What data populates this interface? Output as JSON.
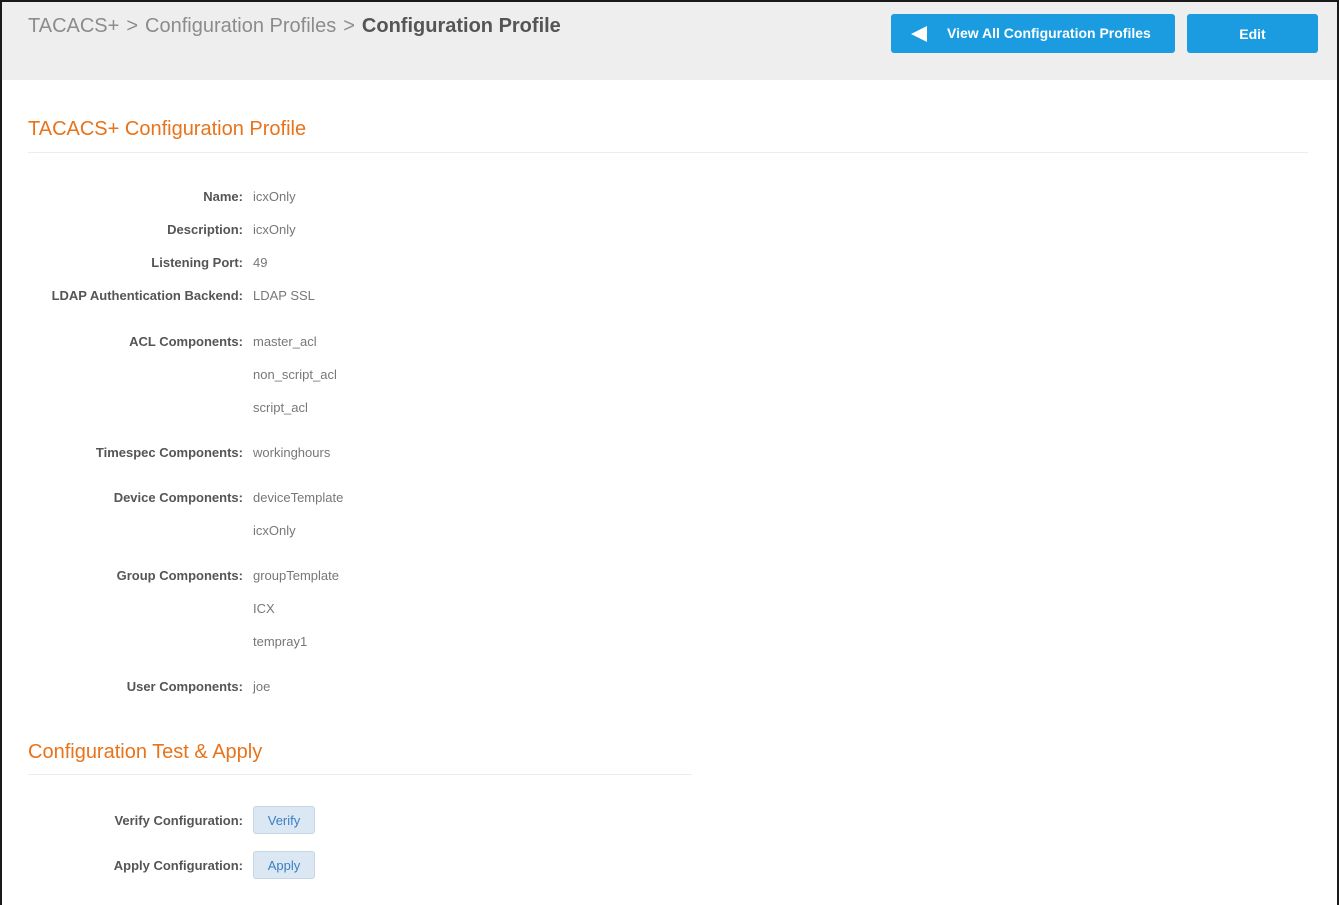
{
  "breadcrumb": {
    "items": [
      "TACACS+",
      "Configuration Profiles"
    ],
    "separator": ">",
    "current": "Configuration Profile"
  },
  "header_buttons": {
    "view_all_label": "View All Configuration Profiles",
    "edit_label": "Edit"
  },
  "profile_section": {
    "title": "TACACS+ Configuration Profile",
    "fields": {
      "name": {
        "label": "Name:",
        "value": "icxOnly"
      },
      "description": {
        "label": "Description:",
        "value": "icxOnly"
      },
      "listening_port": {
        "label": "Listening Port:",
        "value": "49"
      },
      "ldap_backend": {
        "label": "LDAP Authentication Backend:",
        "value": "LDAP SSL"
      },
      "acl_components": {
        "label": "ACL Components:",
        "values": [
          "master_acl",
          "non_script_acl",
          "script_acl"
        ]
      },
      "timespec_components": {
        "label": "Timespec Components:",
        "values": [
          "workinghours"
        ]
      },
      "device_components": {
        "label": "Device Components:",
        "values": [
          "deviceTemplate",
          "icxOnly"
        ]
      },
      "group_components": {
        "label": "Group Components:",
        "values": [
          "groupTemplate",
          "ICX",
          "tempray1"
        ]
      },
      "user_components": {
        "label": "User Components:",
        "values": [
          "joe"
        ]
      }
    }
  },
  "test_section": {
    "title": "Configuration Test & Apply",
    "verify": {
      "label": "Verify Configuration:",
      "button": "Verify"
    },
    "apply": {
      "label": "Apply Configuration:",
      "button": "Apply"
    }
  },
  "colors": {
    "accent_orange": "#e8731a",
    "primary_blue": "#1b9ce0",
    "light_button": "#dbe7f3"
  },
  "icons": {
    "back_arrow": "arrow-left-icon"
  }
}
